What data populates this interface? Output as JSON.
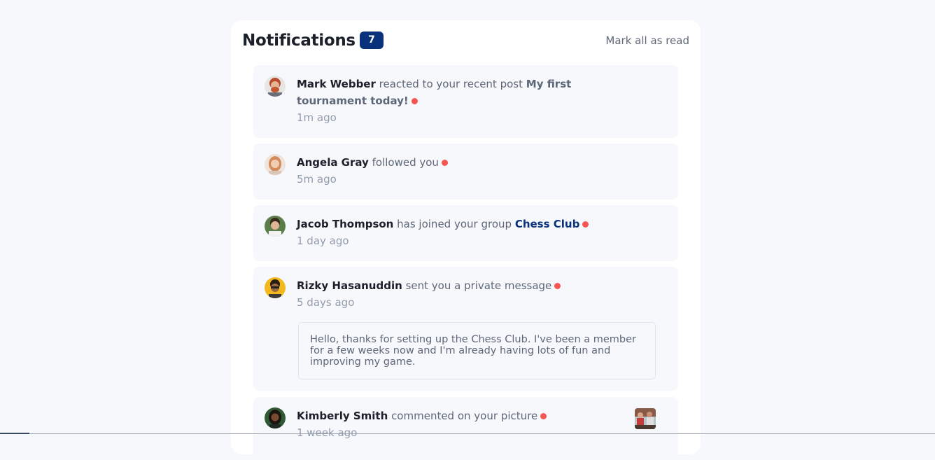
{
  "header": {
    "title": "Notifications",
    "count": "7",
    "mark_all_label": "Mark all as read"
  },
  "notifications": [
    {
      "name": "Mark Webber",
      "action": "reacted to your recent post",
      "post": "My first tournament today!",
      "time": "1m ago",
      "unread": true
    },
    {
      "name": "Angela Gray",
      "action": "followed you",
      "time": "5m ago",
      "unread": true
    },
    {
      "name": "Jacob Thompson",
      "action": "has joined your group",
      "group": "Chess Club",
      "time": "1 day ago",
      "unread": true
    },
    {
      "name": "Rizky Hasanuddin",
      "action": "sent you a private message",
      "time": "5 days ago",
      "message": "Hello, thanks for setting up the Chess Club. I've been a member for a few weeks now and I'm already having lots of fun and improving my game.",
      "unread": true
    },
    {
      "name": "Kimberly Smith",
      "action": "commented on your picture",
      "time": "1 week ago",
      "unread": true
    }
  ],
  "colors": {
    "accent": "#0a317b",
    "unread_dot": "#f65552",
    "text_dark": "#1c202b",
    "text_muted": "#5e6778",
    "time": "#939cad",
    "item_bg": "#f6f8fc"
  },
  "icons": [
    "avatar-mark-webber",
    "avatar-angela-gray",
    "avatar-jacob-thompson",
    "avatar-rizky-hasanuddin",
    "avatar-kimberly-smith",
    "chess-picture-thumbnail"
  ]
}
